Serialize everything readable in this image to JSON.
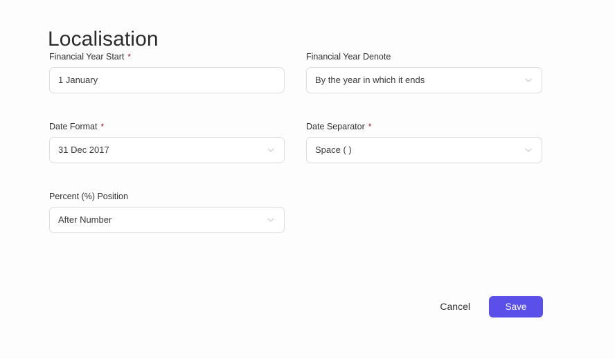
{
  "page": {
    "title": "Localisation",
    "accent_color": "#5b4fe9",
    "required_marker": "*",
    "required_marker_color": "#8c1b2b"
  },
  "form": {
    "rows": [
      {
        "left": {
          "label": "Financial Year Start",
          "required": true,
          "value": "1 January",
          "type": "text",
          "icon": ""
        },
        "right": {
          "label": "Financial Year Denote",
          "required": false,
          "value": "By the year in which it ends",
          "type": "select",
          "icon": "chevron-down-icon"
        }
      },
      {
        "left": {
          "label": "Date Format",
          "required": true,
          "value": "31 Dec 2017",
          "type": "select",
          "icon": "chevron-down-icon"
        },
        "right": {
          "label": "Date Separator",
          "required": true,
          "value": "Space ( )",
          "type": "select",
          "icon": "chevron-down-icon"
        }
      },
      {
        "left": {
          "label": "Percent (%) Position",
          "required": false,
          "value": "After Number",
          "type": "select",
          "icon": "chevron-down-icon"
        },
        "right": null
      }
    ]
  },
  "actions": {
    "cancel_label": "Cancel",
    "save_label": "Save"
  }
}
